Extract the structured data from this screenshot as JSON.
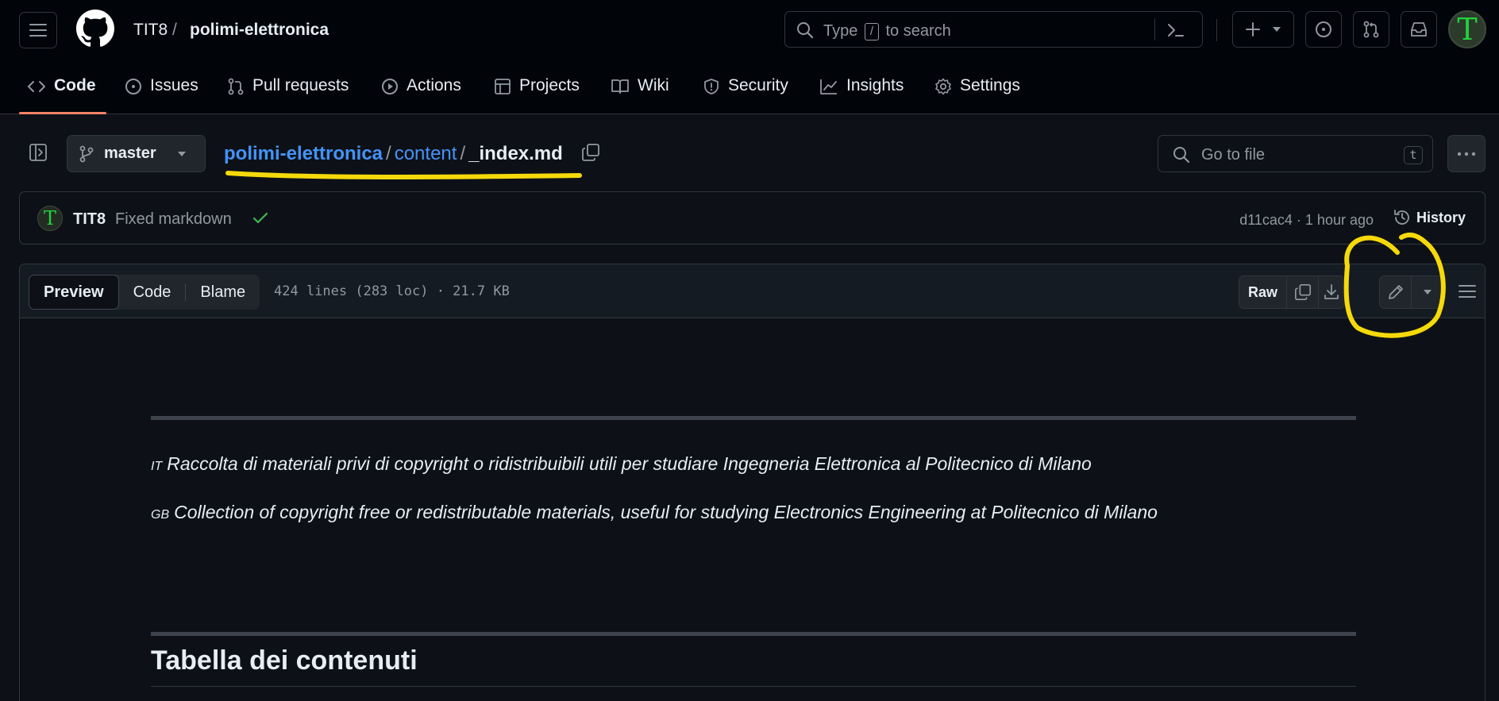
{
  "header": {
    "owner": "TIT8",
    "separator": "/",
    "repo": "polimi-elettronica",
    "search_prefix": "Type",
    "search_key": "/",
    "search_suffix": "to search",
    "avatar_initial": "T"
  },
  "nav": {
    "items": [
      {
        "label": "Code",
        "icon": "code-icon",
        "active": true
      },
      {
        "label": "Issues",
        "icon": "issue-opened-icon"
      },
      {
        "label": "Pull requests",
        "icon": "git-pull-request-icon"
      },
      {
        "label": "Actions",
        "icon": "play-icon"
      },
      {
        "label": "Projects",
        "icon": "table-icon"
      },
      {
        "label": "Wiki",
        "icon": "book-icon"
      },
      {
        "label": "Security",
        "icon": "shield-icon"
      },
      {
        "label": "Insights",
        "icon": "graph-icon"
      },
      {
        "label": "Settings",
        "icon": "gear-icon"
      }
    ]
  },
  "file": {
    "branch": "master",
    "path": [
      {
        "label": "polimi-elettronica"
      },
      {
        "label": "content"
      }
    ],
    "path_sep": "/",
    "filename": "_index.md",
    "goto_placeholder": "Go to file",
    "goto_key": "t"
  },
  "commit": {
    "avatar_initial": "T",
    "author": "TIT8",
    "message": "Fixed markdown",
    "hash_time": "d11cac4 · 1 hour ago",
    "history_label": "History"
  },
  "viewer": {
    "tabs": [
      "Preview",
      "Code",
      "Blame"
    ],
    "selected_tab": "Preview",
    "meta": "424 lines (283 loc) · 21.7 KB",
    "raw_label": "Raw"
  },
  "markdown": {
    "line1_flag": "IT",
    "line1_text": "Raccolta di materiali privi di copyright o ridistribuibili utili per studiare Ingegneria Elettronica al Politecnico di Milano",
    "line2_flag": "GB",
    "line2_text": "Collection of copyright free or redistributable materials, useful for studying Electronics Engineering at Politecnico di Milano",
    "heading": "Tabella dei contenuti"
  },
  "colors": {
    "background": "#0d1117",
    "header": "#010409",
    "link": "#4493f8",
    "nav_underline": "#f78166",
    "annotation": "#f5d90a",
    "success": "#3fb950"
  }
}
